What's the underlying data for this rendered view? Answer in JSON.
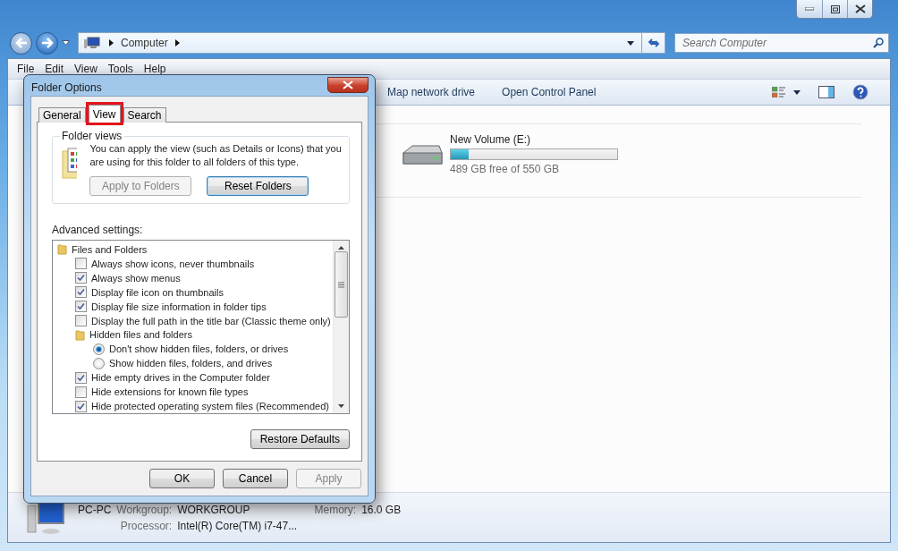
{
  "explorer": {
    "address": {
      "crumbs": [
        "Computer"
      ]
    },
    "search": {
      "placeholder": "Search Computer"
    },
    "menu": [
      "File",
      "Edit",
      "View",
      "Tools",
      "Help"
    ],
    "toolbar": [
      "Map network drive",
      "Open Control Panel"
    ],
    "drives": [
      {
        "name": "New Volume (E:)",
        "level": 0.11,
        "free": "489 GB free of 550 GB"
      }
    ],
    "details": {
      "name": "PC-PC",
      "workgroup_label": "Workgroup:",
      "workgroup": "WORKGROUP",
      "memory_label": "Memory:",
      "memory": "16.0 GB",
      "processor_label": "Processor:",
      "processor": "Intel(R) Core(TM) i7-47..."
    }
  },
  "dialog": {
    "title": "Folder Options",
    "tabs": [
      {
        "label": "General",
        "selected": false,
        "highlighted": false
      },
      {
        "label": "View",
        "selected": true,
        "highlighted": true
      },
      {
        "label": "Search",
        "selected": false,
        "highlighted": false
      }
    ],
    "folder_views": {
      "title": "Folder views",
      "text": "You can apply the view (such as Details or Icons) that you are using for this folder to all folders of this type.",
      "buttons": [
        {
          "label": "Apply to Folders",
          "disabled": true,
          "focused": false
        },
        {
          "label": "Reset Folders",
          "disabled": false,
          "focused": true
        }
      ]
    },
    "advanced_label": "Advanced settings:",
    "settings": [
      {
        "kind": "folder",
        "label": "Files and Folders",
        "children": [
          {
            "kind": "checkbox",
            "label": "Always show icons, never thumbnails",
            "checked": false
          },
          {
            "kind": "checkbox",
            "label": "Always show menus",
            "checked": true
          },
          {
            "kind": "checkbox",
            "label": "Display file icon on thumbnails",
            "checked": true
          },
          {
            "kind": "checkbox",
            "label": "Display file size information in folder tips",
            "checked": true
          },
          {
            "kind": "checkbox",
            "label": "Display the full path in the title bar (Classic theme only)",
            "checked": false
          },
          {
            "kind": "folder",
            "label": "Hidden files and folders",
            "children": [
              {
                "kind": "radio",
                "label": "Don't show hidden files, folders, or drives",
                "selected": true
              },
              {
                "kind": "radio",
                "label": "Show hidden files, folders, and drives",
                "selected": false
              }
            ]
          },
          {
            "kind": "checkbox",
            "label": "Hide empty drives in the Computer folder",
            "checked": true
          },
          {
            "kind": "checkbox",
            "label": "Hide extensions for known file types",
            "checked": false
          },
          {
            "kind": "checkbox",
            "label": "Hide protected operating system files (Recommended)",
            "checked": true
          }
        ]
      }
    ],
    "restore": "Restore Defaults",
    "buttons": [
      {
        "label": "OK",
        "disabled": false
      },
      {
        "label": "Cancel",
        "disabled": false
      },
      {
        "label": "Apply",
        "disabled": true
      }
    ]
  }
}
